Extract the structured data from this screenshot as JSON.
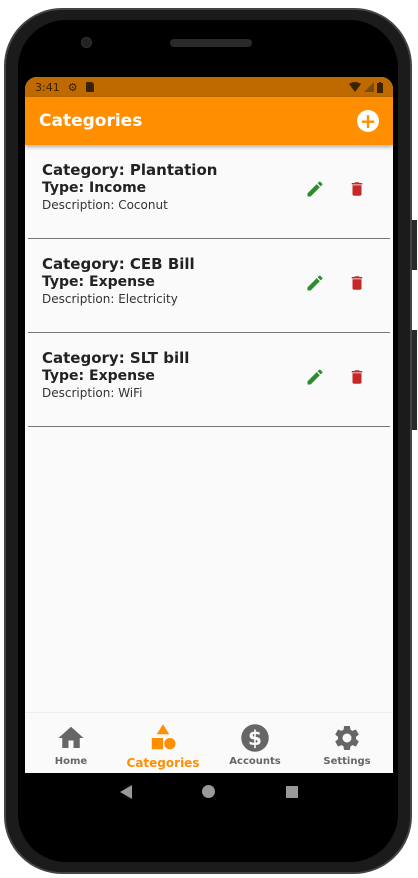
{
  "status": {
    "time": "3:41"
  },
  "appbar": {
    "title": "Categories",
    "add_icon": "plus-circle-icon"
  },
  "colors": {
    "primary": "#ff8f00",
    "edit": "#2e8b2e",
    "delete": "#c62828"
  },
  "categories": [
    {
      "category": "Category: Plantation",
      "type": "Type: Income",
      "description": "Description: Coconut"
    },
    {
      "category": "Category: CEB Bill",
      "type": "Type: Expense",
      "description": "Description: Electricity"
    },
    {
      "category": "Category: SLT bill",
      "type": "Type: Expense",
      "description": "Description: WiFi"
    }
  ],
  "bottom_nav": [
    {
      "label": "Home",
      "icon": "home-icon"
    },
    {
      "label": "Categories",
      "icon": "shapes-icon",
      "active": true
    },
    {
      "label": "Accounts",
      "icon": "dollar-circle-icon"
    },
    {
      "label": "Settings",
      "icon": "gear-icon"
    }
  ]
}
